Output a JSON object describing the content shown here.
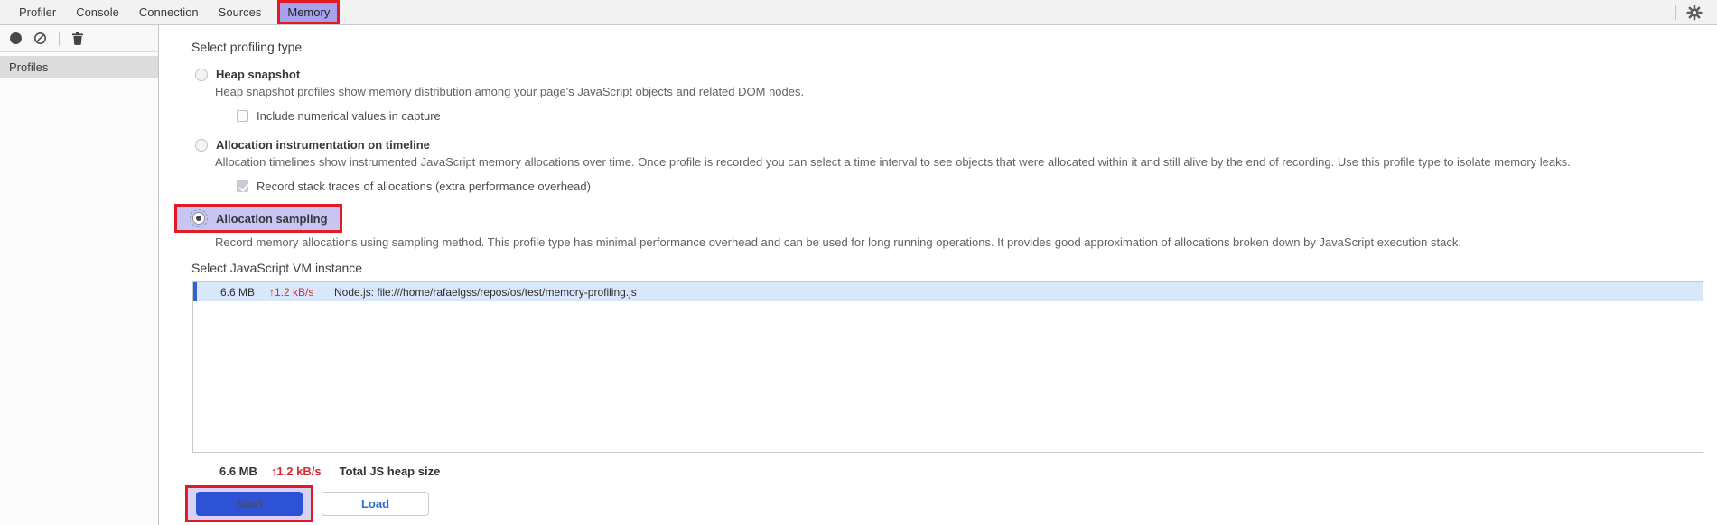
{
  "tabbar": {
    "tabs": [
      {
        "label": "Profiler",
        "active": false
      },
      {
        "label": "Console",
        "active": false
      },
      {
        "label": "Connection",
        "active": false
      },
      {
        "label": "Sources",
        "active": false
      },
      {
        "label": "Memory",
        "active": true,
        "highlighted": true
      }
    ],
    "icons": {
      "settings": "gear-icon"
    }
  },
  "sidebar": {
    "toolbar_icons": {
      "record": "record-icon",
      "clear": "block-icon",
      "delete": "trash-icon"
    },
    "profiles_label": "Profiles"
  },
  "main": {
    "profiling_type": {
      "heading": "Select profiling type",
      "options": [
        {
          "label": "Heap snapshot",
          "selected": false,
          "description": "Heap snapshot profiles show memory distribution among your page's JavaScript objects and related DOM nodes.",
          "sub_option": {
            "label": "Include numerical values in capture",
            "checked": false,
            "disabled": false
          }
        },
        {
          "label": "Allocation instrumentation on timeline",
          "selected": false,
          "description": "Allocation timelines show instrumented JavaScript memory allocations over time. Once profile is recorded you can select a time interval to see objects that were allocated within it and still alive by the end of recording. Use this profile type to isolate memory leaks.",
          "sub_option": {
            "label": "Record stack traces of allocations (extra performance overhead)",
            "checked": true,
            "disabled": true
          }
        },
        {
          "label": "Allocation sampling",
          "selected": true,
          "highlighted": true,
          "description": "Record memory allocations using sampling method. This profile type has minimal performance overhead and can be used for long running operations. It provides good approximation of allocations broken down by JavaScript execution stack."
        }
      ]
    },
    "vm_instance": {
      "heading": "Select JavaScript VM instance",
      "rows": [
        {
          "size": "6.6 MB",
          "rate": "↑1.2 kB/s",
          "name": "Node.js: file:///home/rafaelgss/repos/os/test/memory-profiling.js",
          "selected": true
        }
      ],
      "total": {
        "size": "6.6 MB",
        "rate": "↑1.2 kB/s",
        "label": "Total JS heap size"
      }
    },
    "actions": {
      "start_label": "Start",
      "load_label": "Load"
    }
  },
  "colors": {
    "annotation_red": "#e11b23",
    "tab_highlight_bg": "#a5a1ec",
    "option_highlight_bg": "#c9c5f3",
    "row_selected_bg": "#d9e7fb",
    "row_selected_stripe": "#2f62d3",
    "rate_red": "#d7282f",
    "start_button_bg": "#2d52d3",
    "load_button_text": "#2e6bdf",
    "tabbar_bg": "#f2f2f2",
    "sidebar_selected_bg": "#dcdcdc"
  }
}
